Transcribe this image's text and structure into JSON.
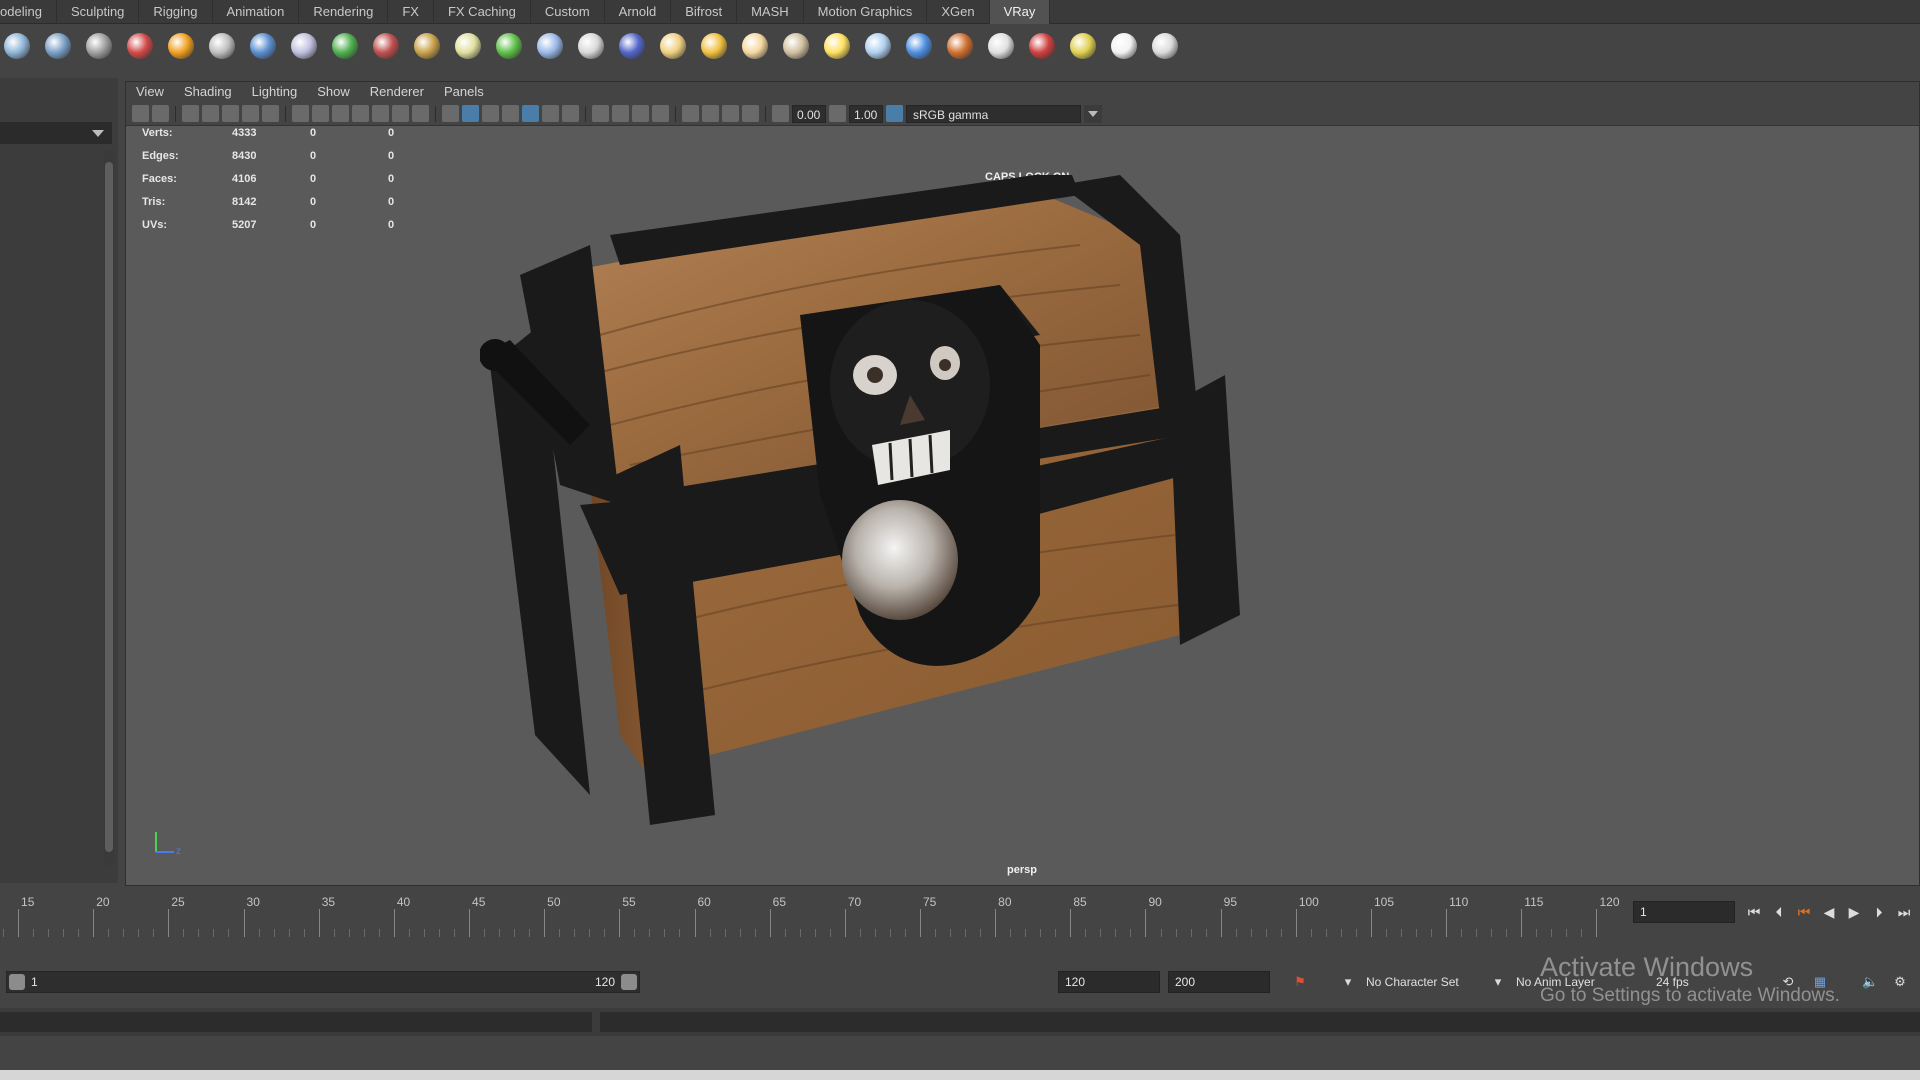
{
  "shelf_tabs": [
    "odeling",
    "Sculpting",
    "Rigging",
    "Animation",
    "Rendering",
    "FX",
    "FX Caching",
    "Custom",
    "Arnold",
    "Bifrost",
    "MASH",
    "Motion Graphics",
    "XGen",
    "VRay"
  ],
  "active_shelf_tab": "VRay",
  "shelf_icons": [
    {
      "name": "sphere-render-icon",
      "color": "#8fb6d8"
    },
    {
      "name": "sphere-lit-icon",
      "color": "#7a9fc6"
    },
    {
      "name": "camera-rig-icon",
      "color": "#a0a0a0"
    },
    {
      "name": "material-balls-icon",
      "color": "#d24a4a"
    },
    {
      "name": "fire-icon",
      "color": "#f0a020"
    },
    {
      "name": "mesh-grid-icon",
      "color": "#bfbfbf"
    },
    {
      "name": "cube-proxy-icon",
      "color": "#5b8fd0"
    },
    {
      "name": "particles-icon",
      "color": "#c0c0e0"
    },
    {
      "name": "light-dome-icon",
      "color": "#50b050"
    },
    {
      "name": "fur-icon",
      "color": "#c05050"
    },
    {
      "name": "plane-texture-icon",
      "color": "#c9a24a"
    },
    {
      "name": "globe-icon",
      "color": "#e0e0a0"
    },
    {
      "name": "grass-icon",
      "color": "#5fc04a"
    },
    {
      "name": "snowflake-icon",
      "color": "#9ab8e8"
    },
    {
      "name": "rope-icon",
      "color": "#d8d8d8"
    },
    {
      "name": "sphere-blue-icon",
      "color": "#5466c9"
    },
    {
      "name": "dome-light-icon",
      "color": "#f0d080"
    },
    {
      "name": "spot-light-icon",
      "color": "#f0c040"
    },
    {
      "name": "sphere-light-icon",
      "color": "#f5d8a0"
    },
    {
      "name": "ies-light-icon",
      "color": "#d0c0a0"
    },
    {
      "name": "sun-icon",
      "color": "#ffe060"
    },
    {
      "name": "plane-light-icon",
      "color": "#b0d0f0"
    },
    {
      "name": "sphere-glossy-icon",
      "color": "#4f8fe0"
    },
    {
      "name": "color-wheel-icon",
      "color": "#d07030"
    },
    {
      "name": "checker-icon",
      "color": "#e0e0e0"
    },
    {
      "name": "frame-buffer-icon",
      "color": "#d04040"
    },
    {
      "name": "light-lister-icon",
      "color": "#e0d050"
    },
    {
      "name": "cloud-icon",
      "color": "#f2f2f2"
    },
    {
      "name": "help-icon",
      "color": "#dcdcdc"
    }
  ],
  "viewport_menus": [
    "View",
    "Shading",
    "Lighting",
    "Show",
    "Renderer",
    "Panels"
  ],
  "toolbar": {
    "exposure": "0.00",
    "gamma": "1.00",
    "color_space": "sRGB gamma"
  },
  "hud": {
    "rows": [
      {
        "label": "Verts:",
        "total": "4333",
        "sel": "0",
        "comp": "0"
      },
      {
        "label": "Edges:",
        "total": "8430",
        "sel": "0",
        "comp": "0"
      },
      {
        "label": "Faces:",
        "total": "4106",
        "sel": "0",
        "comp": "0"
      },
      {
        "label": "Tris:",
        "total": "8142",
        "sel": "0",
        "comp": "0"
      },
      {
        "label": "UVs:",
        "total": "5207",
        "sel": "0",
        "comp": "0"
      }
    ],
    "caps_lock": "CAPS LOCK ON",
    "camera": "persp"
  },
  "timeline": {
    "ticks": [
      "15",
      "20",
      "25",
      "30",
      "35",
      "40",
      "45",
      "50",
      "55",
      "60",
      "65",
      "70",
      "75",
      "80",
      "85",
      "90",
      "95",
      "100",
      "105",
      "110",
      "115",
      "120"
    ],
    "current_frame": "1"
  },
  "range": {
    "start": "1",
    "end": "120",
    "anim_end": "120",
    "playback_end": "200",
    "character_set": "No Character Set",
    "anim_layer": "No Anim Layer",
    "fps": "24 fps"
  },
  "watermark": {
    "title": "Activate Windows",
    "subtitle": "Go to Settings to activate Windows."
  }
}
